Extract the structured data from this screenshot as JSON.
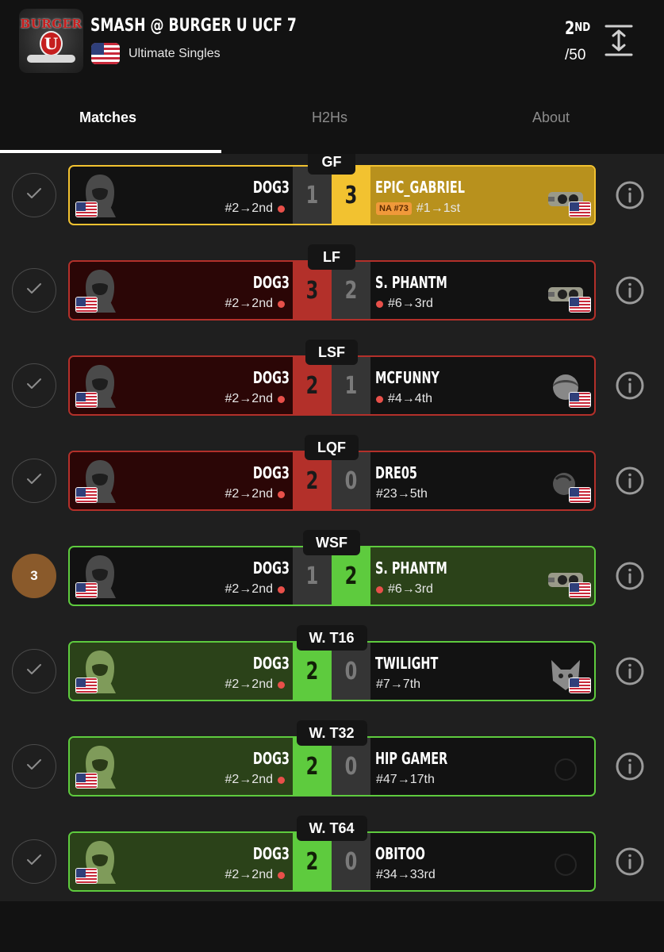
{
  "header": {
    "logo_text": "BURGER",
    "logo_letter": "U",
    "title": "SMASH @ BURGER U UCF 7",
    "event": "Ultimate Singles",
    "placement_num": "2",
    "placement_suffix": "ND",
    "total": "/50"
  },
  "tabs": [
    "Matches",
    "H2Hs",
    "About"
  ],
  "matches": [
    {
      "round": "GF",
      "status": "check",
      "left_name": "DOG3",
      "left_seed": "#2→2nd",
      "left_score": "1",
      "right_score": "3",
      "right_name": "EPIC_GABRIEL",
      "right_badge": "NA #73",
      "right_seed": "#1→1st",
      "right_dot": false,
      "style": "gold",
      "right_char": "robot"
    },
    {
      "round": "LF",
      "status": "check",
      "left_name": "DOG3",
      "left_seed": "#2→2nd",
      "left_score": "3",
      "right_score": "2",
      "right_name": "S. PHANTM",
      "right_badge": "",
      "right_seed": "#6→3rd",
      "right_dot": true,
      "style": "loss-win",
      "right_char": "robot"
    },
    {
      "round": "LSF",
      "status": "check",
      "left_name": "DOG3",
      "left_seed": "#2→2nd",
      "left_score": "2",
      "right_score": "1",
      "right_name": "MCFUNNY",
      "right_badge": "",
      "right_seed": "#4→4th",
      "right_dot": true,
      "style": "loss-win",
      "right_char": "head"
    },
    {
      "round": "LQF",
      "status": "check",
      "left_name": "DOG3",
      "left_seed": "#2→2nd",
      "left_score": "2",
      "right_score": "0",
      "right_name": "DRE05",
      "right_badge": "",
      "right_seed": "#23→5th",
      "right_dot": false,
      "style": "loss-win",
      "right_char": "ball"
    },
    {
      "round": "WSF",
      "status": "3",
      "left_name": "DOG3",
      "left_seed": "#2→2nd",
      "left_score": "1",
      "right_score": "2",
      "right_name": "S. PHANTM",
      "right_badge": "",
      "right_seed": "#6→3rd",
      "right_dot": true,
      "style": "win-right",
      "right_char": "robot"
    },
    {
      "round": "W. T16",
      "status": "check",
      "left_name": "DOG3",
      "left_seed": "#2→2nd",
      "left_score": "2",
      "right_score": "0",
      "right_name": "TWILIGHT",
      "right_badge": "",
      "right_seed": "#7→7th",
      "right_dot": false,
      "style": "win-left",
      "right_char": "fox"
    },
    {
      "round": "W. T32",
      "status": "check",
      "left_name": "DOG3",
      "left_seed": "#2→2nd",
      "left_score": "2",
      "right_score": "0",
      "right_name": "HIP GAMER",
      "right_badge": "",
      "right_seed": "#47→17th",
      "right_dot": false,
      "style": "win-left",
      "right_char": "none"
    },
    {
      "round": "W. T64",
      "status": "check",
      "left_name": "DOG3",
      "left_seed": "#2→2nd",
      "left_score": "2",
      "right_score": "0",
      "right_name": "OBITOO",
      "right_badge": "",
      "right_seed": "#34→33rd",
      "right_dot": false,
      "style": "win-left",
      "right_char": "none"
    }
  ],
  "colors": {
    "loss": "#b3302a",
    "win": "#5ecb3e",
    "gold": "#f2c230",
    "status_num": "#8a5a2b"
  }
}
